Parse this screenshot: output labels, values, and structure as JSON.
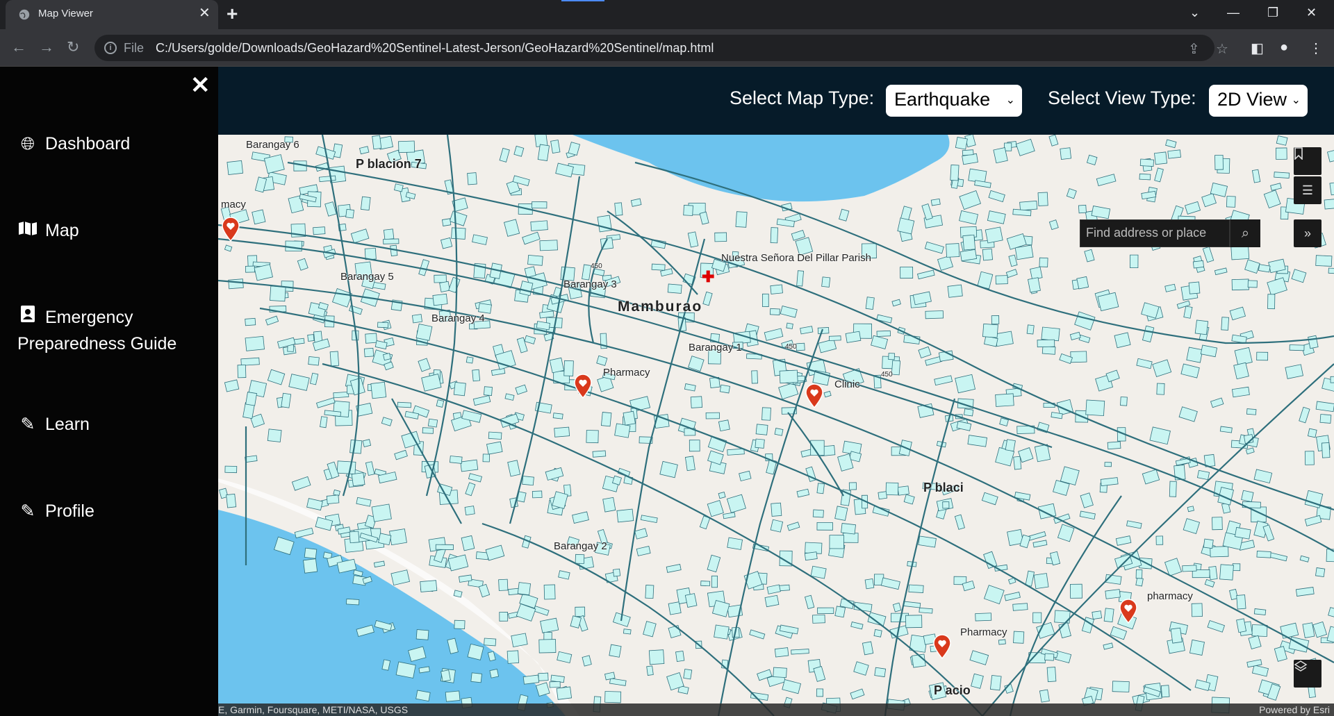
{
  "browser": {
    "tab_title": "Map Viewer",
    "file_label": "File",
    "url": "C:/Users/golde/Downloads/GeoHazard%20Sentinel-Latest-Jerson/GeoHazard%20Sentinel/map.html"
  },
  "sidebar": {
    "items": [
      {
        "label": "Dashboard",
        "icon": "globe-icon"
      },
      {
        "label": "Map",
        "icon": "map-icon"
      },
      {
        "label": "Emergency",
        "label2": "Preparedness Guide",
        "icon": "contact-book-icon"
      },
      {
        "label": "Learn",
        "icon": "pencil-icon"
      },
      {
        "label": "Profile",
        "icon": "pencil-icon"
      }
    ]
  },
  "topbar": {
    "map_type_label": "Select Map Type:",
    "map_type_value": "Earthquake",
    "view_type_label": "Select View Type:",
    "view_type_value": "2D View"
  },
  "map": {
    "search_placeholder": "Find address or place",
    "labels": {
      "barangay6": "Barangay 6",
      "poblacion7": "P  blacion 7",
      "barangay5": "Barangay 5",
      "barangay3": "Barangay 3",
      "barangay4": "Barangay 4",
      "mamburao": "Mamburao",
      "barangay1": "Barangay 1",
      "parish": "Nuestra Señora Del Pillar Parish",
      "pharmacy1": "Pharmacy",
      "clinic": "Clinic",
      "poblacion": "P  blaci",
      "barangay2": "Barangay 2",
      "pharmacy2": "Pharmacy",
      "pharmacy3": "pharmacy",
      "poblacio": "P    acio",
      "macy": "macy",
      "road450a": "450",
      "road450b": "450",
      "road450c": "450"
    },
    "attribution_left": "E, Garmin, Foursquare, METI/NASA, USGS",
    "attribution_right": "Powered by Esri"
  },
  "colors": {
    "water": "#6cc3ee",
    "building": "#c9f5f2",
    "road": "#2e6f7c",
    "land": "#f2efea",
    "pin": "#d9391c",
    "topbar": "#061b29"
  }
}
